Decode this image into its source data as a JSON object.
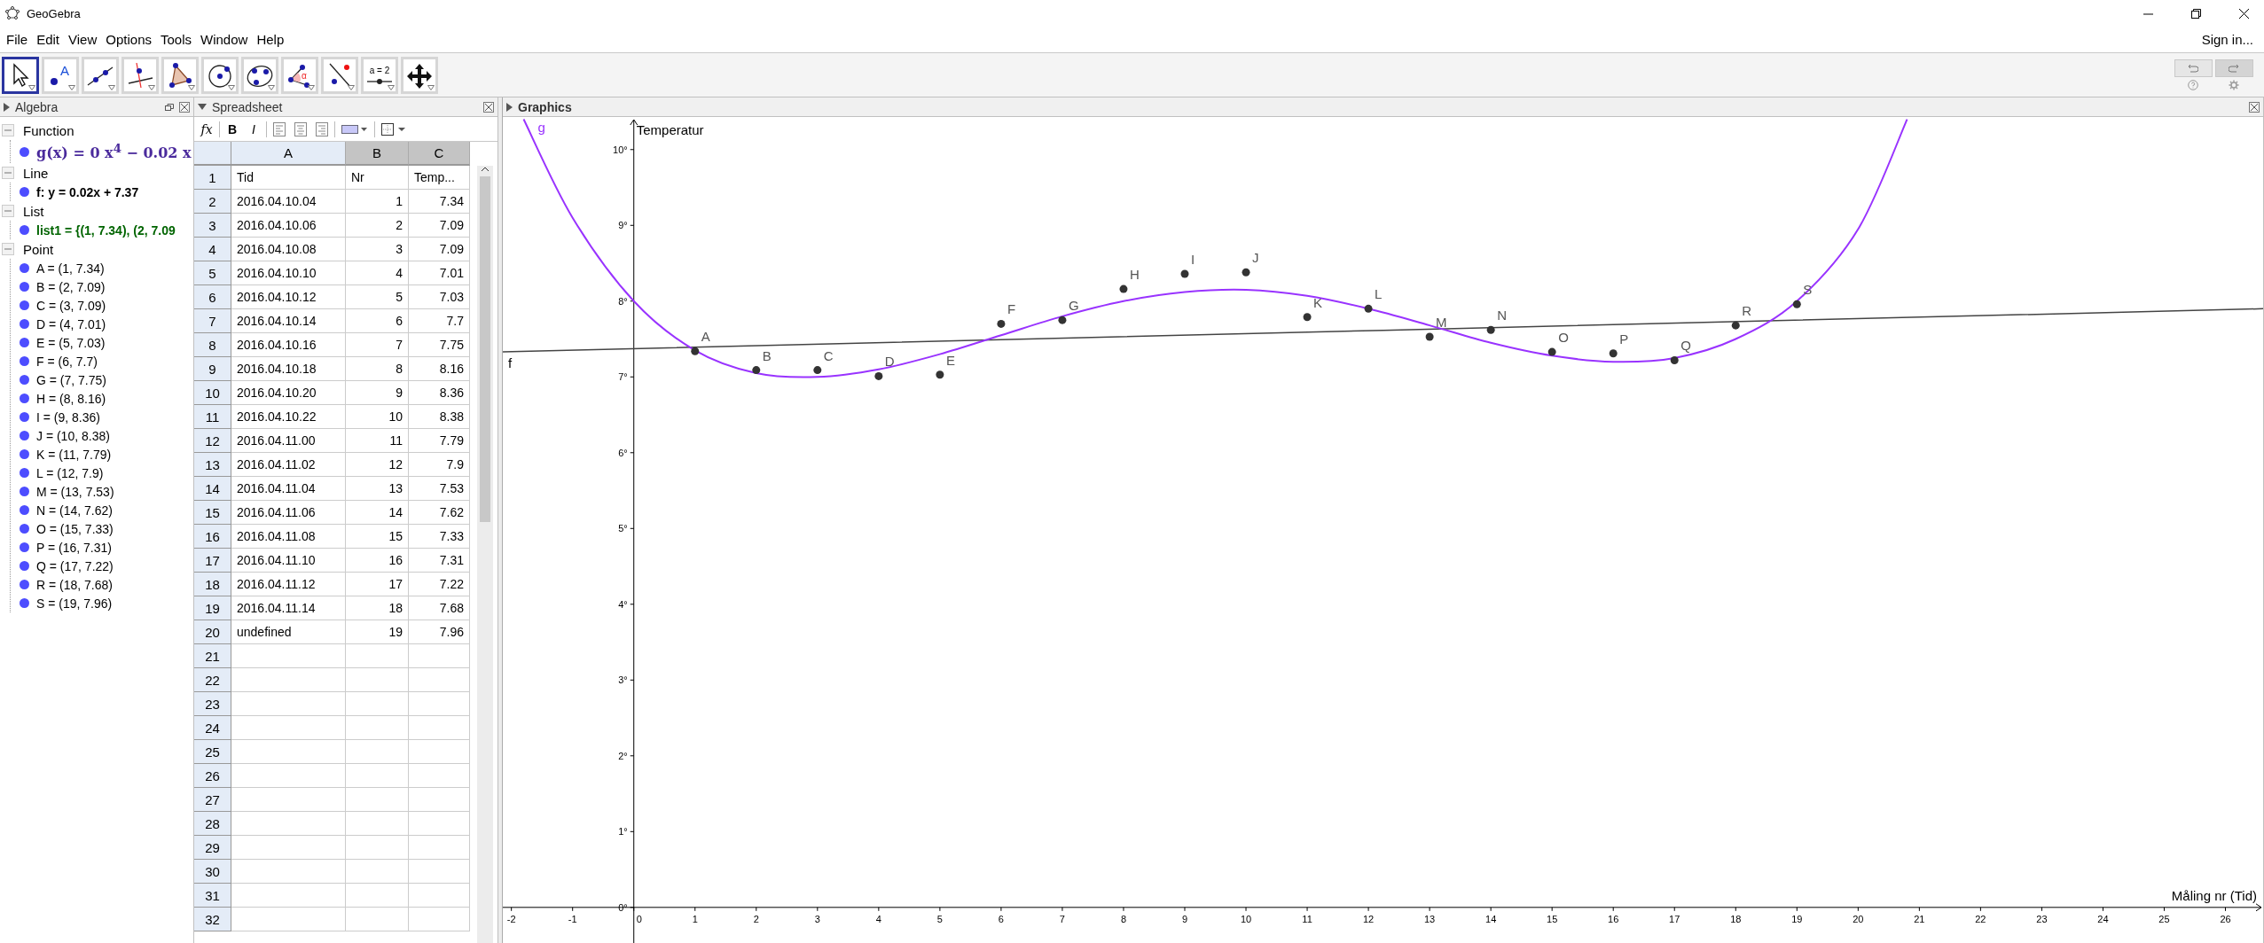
{
  "window": {
    "title": "GeoGebra"
  },
  "menu": [
    "File",
    "Edit",
    "View",
    "Options",
    "Tools",
    "Window",
    "Help"
  ],
  "sign_in": "Sign in...",
  "toolbar": {
    "tools": [
      {
        "kind": "move",
        "selected": true
      },
      {
        "kind": "point",
        "label": "A",
        "selected": false
      },
      {
        "kind": "line",
        "selected": false
      },
      {
        "kind": "perpendicular",
        "selected": false
      },
      {
        "kind": "polygon",
        "selected": false
      },
      {
        "kind": "circle",
        "selected": false
      },
      {
        "kind": "conic",
        "selected": false
      },
      {
        "kind": "angle",
        "label": "α",
        "selected": false
      },
      {
        "kind": "reflect",
        "selected": false
      },
      {
        "kind": "slider",
        "label": "a = 2",
        "selected": false
      },
      {
        "kind": "move-view",
        "selected": false
      }
    ]
  },
  "algebra": {
    "title": "Algebra",
    "style_bar_open": false,
    "groups": [
      {
        "title": "Function",
        "expanded": true,
        "items": [
          {
            "text": "g(x) = 0 x$^{4}$ − 0.02 x",
            "kind": "formula",
            "color": "#4a2a9c"
          }
        ]
      },
      {
        "title": "Line",
        "expanded": true,
        "items": [
          {
            "text": "f: y = 0.02x + 7.37",
            "kind": "bold",
            "color": "#000000"
          }
        ]
      },
      {
        "title": "List",
        "expanded": true,
        "items": [
          {
            "text": "list1 = {(1, 7.34), (2, 7.09",
            "kind": "bold",
            "color": "#006400"
          }
        ]
      },
      {
        "title": "Point",
        "expanded": true,
        "items": [
          {
            "text": "A = (1, 7.34)",
            "kind": "plain",
            "color": "#000000"
          },
          {
            "text": "B = (2, 7.09)",
            "kind": "plain",
            "color": "#000000"
          },
          {
            "text": "C = (3, 7.09)",
            "kind": "plain",
            "color": "#000000"
          },
          {
            "text": "D = (4, 7.01)",
            "kind": "plain",
            "color": "#000000"
          },
          {
            "text": "E = (5, 7.03)",
            "kind": "plain",
            "color": "#000000"
          },
          {
            "text": "F = (6, 7.7)",
            "kind": "plain",
            "color": "#000000"
          },
          {
            "text": "G = (7, 7.75)",
            "kind": "plain",
            "color": "#000000"
          },
          {
            "text": "H = (8, 8.16)",
            "kind": "plain",
            "color": "#000000"
          },
          {
            "text": "I = (9, 8.36)",
            "kind": "plain",
            "color": "#000000"
          },
          {
            "text": "J = (10, 8.38)",
            "kind": "plain",
            "color": "#000000"
          },
          {
            "text": "K = (11, 7.79)",
            "kind": "plain",
            "color": "#000000"
          },
          {
            "text": "L = (12, 7.9)",
            "kind": "plain",
            "color": "#000000"
          },
          {
            "text": "M = (13, 7.53)",
            "kind": "plain",
            "color": "#000000"
          },
          {
            "text": "N = (14, 7.62)",
            "kind": "plain",
            "color": "#000000"
          },
          {
            "text": "O = (15, 7.33)",
            "kind": "plain",
            "color": "#000000"
          },
          {
            "text": "P = (16, 7.31)",
            "kind": "plain",
            "color": "#000000"
          },
          {
            "text": "Q = (17, 7.22)",
            "kind": "plain",
            "color": "#000000"
          },
          {
            "text": "R = (18, 7.68)",
            "kind": "plain",
            "color": "#000000"
          },
          {
            "text": "S = (19, 7.96)",
            "kind": "plain",
            "color": "#000000"
          }
        ]
      }
    ]
  },
  "spreadsheet": {
    "title": "Spreadsheet",
    "style_bar_open": true,
    "style_bar": [
      {
        "kind": "input",
        "label": "fx"
      },
      {
        "kind": "bold",
        "label": "B"
      },
      {
        "kind": "italic",
        "label": "I"
      },
      {
        "kind": "align-left"
      },
      {
        "kind": "align-center"
      },
      {
        "kind": "align-right"
      },
      {
        "kind": "fill"
      },
      {
        "kind": "border"
      }
    ],
    "columns": [
      {
        "label": "A",
        "selected": false
      },
      {
        "label": "B",
        "selected": true
      },
      {
        "label": "C",
        "selected": true
      }
    ],
    "rows": [
      {
        "number": "1",
        "kind": "text",
        "cells": [
          "Tid",
          "Nr",
          "Temp..."
        ]
      },
      {
        "number": "2",
        "kind": "data",
        "cells": [
          "2016.04.10.04",
          "1",
          "7.34"
        ]
      },
      {
        "number": "3",
        "kind": "data",
        "cells": [
          "2016.04.10.06",
          "2",
          "7.09"
        ]
      },
      {
        "number": "4",
        "kind": "data",
        "cells": [
          "2016.04.10.08",
          "3",
          "7.09"
        ]
      },
      {
        "number": "5",
        "kind": "data",
        "cells": [
          "2016.04.10.10",
          "4",
          "7.01"
        ]
      },
      {
        "number": "6",
        "kind": "data",
        "cells": [
          "2016.04.10.12",
          "5",
          "7.03"
        ]
      },
      {
        "number": "7",
        "kind": "data",
        "cells": [
          "2016.04.10.14",
          "6",
          "7.7"
        ]
      },
      {
        "number": "8",
        "kind": "data",
        "cells": [
          "2016.04.10.16",
          "7",
          "7.75"
        ]
      },
      {
        "number": "9",
        "kind": "data",
        "cells": [
          "2016.04.10.18",
          "8",
          "8.16"
        ]
      },
      {
        "number": "10",
        "kind": "data",
        "cells": [
          "2016.04.10.20",
          "9",
          "8.36"
        ]
      },
      {
        "number": "11",
        "kind": "data",
        "cells": [
          "2016.04.10.22",
          "10",
          "8.38"
        ]
      },
      {
        "number": "12",
        "kind": "data",
        "cells": [
          "2016.04.11.00",
          "11",
          "7.79"
        ]
      },
      {
        "number": "13",
        "kind": "data",
        "cells": [
          "2016.04.11.02",
          "12",
          "7.9"
        ]
      },
      {
        "number": "14",
        "kind": "data",
        "cells": [
          "2016.04.11.04",
          "13",
          "7.53"
        ]
      },
      {
        "number": "15",
        "kind": "data",
        "cells": [
          "2016.04.11.06",
          "14",
          "7.62"
        ]
      },
      {
        "number": "16",
        "kind": "data",
        "cells": [
          "2016.04.11.08",
          "15",
          "7.33"
        ]
      },
      {
        "number": "17",
        "kind": "data",
        "cells": [
          "2016.04.11.10",
          "16",
          "7.31"
        ]
      },
      {
        "number": "18",
        "kind": "data",
        "cells": [
          "2016.04.11.12",
          "17",
          "7.22"
        ]
      },
      {
        "number": "19",
        "kind": "data",
        "cells": [
          "2016.04.11.14",
          "18",
          "7.68"
        ]
      },
      {
        "number": "20",
        "kind": "data",
        "cells": [
          "undefined",
          "19",
          "7.96"
        ]
      },
      {
        "number": "21"
      },
      {
        "number": "22"
      },
      {
        "number": "23"
      },
      {
        "number": "24"
      },
      {
        "number": "25"
      },
      {
        "number": "26"
      },
      {
        "number": "27"
      },
      {
        "number": "28"
      },
      {
        "number": "29"
      },
      {
        "number": "30"
      },
      {
        "number": "31"
      },
      {
        "number": "32"
      }
    ]
  },
  "graphics": {
    "title": "Graphics",
    "style_bar_open": false,
    "chart_data": {
      "type": "scatter",
      "xlabel": "Måling nr (Tid)",
      "ylabel": "Temperatur",
      "xlim": [
        -2.14,
        26.63
      ],
      "ylim": [
        -0.47,
        10.43
      ],
      "xticks": [
        -2,
        -1,
        0,
        1,
        2,
        3,
        4,
        5,
        6,
        7,
        8,
        9,
        10,
        11,
        12,
        13,
        14,
        15,
        16,
        17,
        18,
        19,
        20,
        21,
        22,
        23,
        24,
        25,
        26
      ],
      "yticks": [
        {
          "value": 0,
          "label": "0°"
        },
        {
          "value": 1,
          "label": "1°"
        },
        {
          "value": 2,
          "label": "2°"
        },
        {
          "value": 3,
          "label": "3°"
        },
        {
          "value": 4,
          "label": "4°"
        },
        {
          "value": 5,
          "label": "5°"
        },
        {
          "value": 6,
          "label": "6°"
        },
        {
          "value": 7,
          "label": "7°"
        },
        {
          "value": 8,
          "label": "8°"
        },
        {
          "value": 9,
          "label": "9°"
        },
        {
          "value": 10,
          "label": "10°"
        }
      ],
      "series": [
        {
          "name": "f",
          "type": "line",
          "color": "#444444",
          "x": [
            -2.14,
            26.63
          ],
          "values": [
            7.33,
            7.9
          ]
        },
        {
          "name": "g",
          "type": "line",
          "color": "#9933ff",
          "x": [
            -1.8,
            -1,
            0,
            1,
            2,
            3,
            4,
            5,
            6,
            7,
            8,
            9,
            10,
            11,
            12,
            13,
            14,
            15,
            16,
            17,
            18,
            19,
            20,
            20.8
          ],
          "values": [
            10.4,
            9.1,
            8.0,
            7.35,
            7.05,
            7.0,
            7.1,
            7.3,
            7.55,
            7.8,
            8.0,
            8.12,
            8.15,
            8.07,
            7.9,
            7.68,
            7.45,
            7.28,
            7.2,
            7.25,
            7.5,
            8.0,
            8.95,
            10.4
          ]
        },
        {
          "color": "#333333",
          "x": [
            1,
            2,
            3,
            4,
            5,
            6,
            7,
            8,
            9,
            10,
            11,
            12,
            13,
            14,
            15,
            16,
            17,
            18,
            19
          ],
          "values": [
            7.34,
            7.09,
            7.09,
            7.01,
            7.03,
            7.7,
            7.75,
            8.16,
            8.36,
            8.38,
            7.79,
            7.9,
            7.53,
            7.62,
            7.33,
            7.31,
            7.22,
            7.68,
            7.96
          ]
        }
      ],
      "annotations": [
        {
          "text": "A",
          "x": 1,
          "y": 7.34
        },
        {
          "text": "B",
          "x": 2,
          "y": 7.09
        },
        {
          "text": "C",
          "x": 3,
          "y": 7.09
        },
        {
          "text": "D",
          "x": 4,
          "y": 7.01
        },
        {
          "text": "E",
          "x": 5,
          "y": 7.03
        },
        {
          "text": "F",
          "x": 6,
          "y": 7.7
        },
        {
          "text": "G",
          "x": 7,
          "y": 7.75
        },
        {
          "text": "H",
          "x": 8,
          "y": 8.16
        },
        {
          "text": "I",
          "x": 9,
          "y": 8.36
        },
        {
          "text": "J",
          "x": 10,
          "y": 8.38
        },
        {
          "text": "K",
          "x": 11,
          "y": 7.79
        },
        {
          "text": "L",
          "x": 12,
          "y": 7.9
        },
        {
          "text": "M",
          "x": 13,
          "y": 7.53
        },
        {
          "text": "N",
          "x": 14,
          "y": 7.62
        },
        {
          "text": "O",
          "x": 15,
          "y": 7.33
        },
        {
          "text": "P",
          "x": 16,
          "y": 7.31
        },
        {
          "text": "Q",
          "x": 17,
          "y": 7.22
        },
        {
          "text": "R",
          "x": 18,
          "y": 7.68
        },
        {
          "text": "S",
          "x": 19,
          "y": 7.96
        }
      ]
    }
  }
}
